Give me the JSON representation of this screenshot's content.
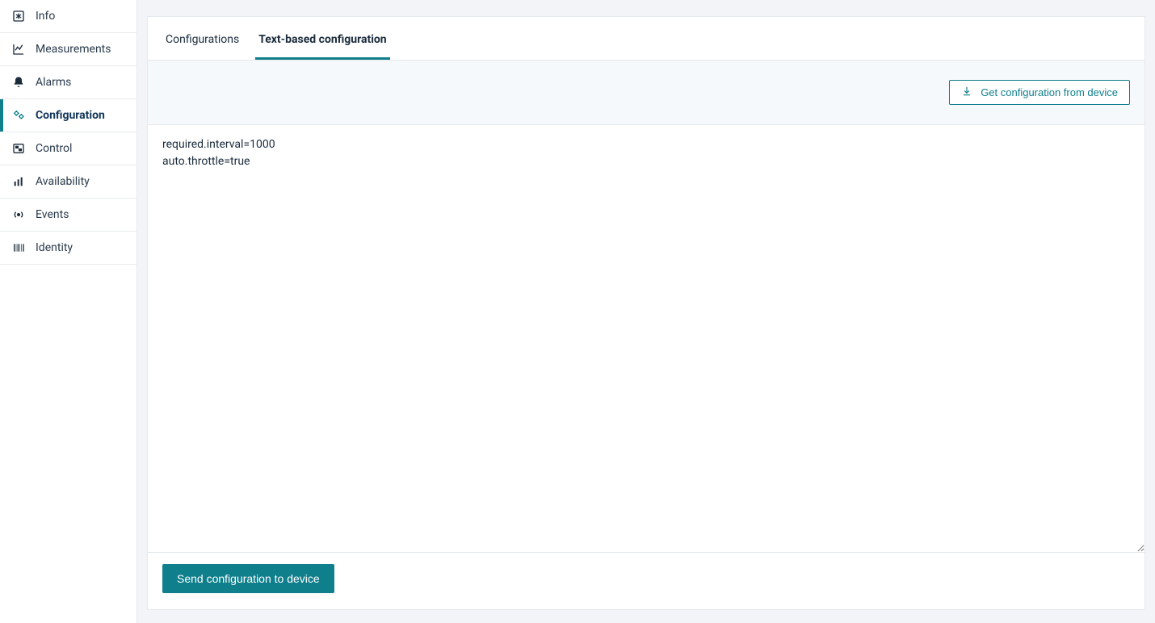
{
  "sidebar": {
    "items": [
      {
        "id": "info",
        "label": "Info",
        "icon": "asterisk-square-icon",
        "active": false
      },
      {
        "id": "measurements",
        "label": "Measurements",
        "icon": "line-chart-icon",
        "active": false
      },
      {
        "id": "alarms",
        "label": "Alarms",
        "icon": "bell-icon",
        "active": false
      },
      {
        "id": "configuration",
        "label": "Configuration",
        "icon": "cogs-icon",
        "active": true
      },
      {
        "id": "control",
        "label": "Control",
        "icon": "toggle-panel-icon",
        "active": false
      },
      {
        "id": "availability",
        "label": "Availability",
        "icon": "bar-chart-icon",
        "active": false
      },
      {
        "id": "events",
        "label": "Events",
        "icon": "broadcast-icon",
        "active": false
      },
      {
        "id": "identity",
        "label": "Identity",
        "icon": "barcode-icon",
        "active": false
      }
    ]
  },
  "tabs": [
    {
      "id": "configurations",
      "label": "Configurations",
      "active": false
    },
    {
      "id": "text-config",
      "label": "Text-based configuration",
      "active": true
    }
  ],
  "toolbar": {
    "get_config_label": "Get configuration from device"
  },
  "editor": {
    "value": "required.interval=1000\nauto.throttle=true"
  },
  "footer": {
    "send_label": "Send configuration to device"
  },
  "colors": {
    "accent": "#0f7f8c",
    "text": "#1a2b3c",
    "border": "#e5e9ed",
    "page_bg": "#f2f4f7",
    "band_bg": "#f6f9fb"
  }
}
